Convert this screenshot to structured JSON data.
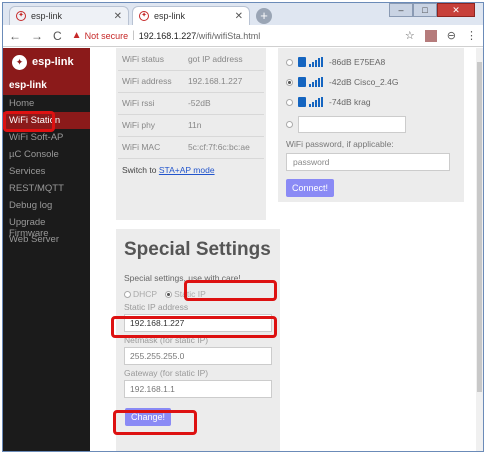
{
  "tabs": [
    {
      "title": "esp-link"
    },
    {
      "title": "esp-link"
    }
  ],
  "address": {
    "warning": "Not secure",
    "host": "192.168.1.227",
    "path": "/wifi/wifiSta.html"
  },
  "sidebar": {
    "brand": "esp-link",
    "subtitle": "esp-link",
    "items": [
      {
        "label": "Home"
      },
      {
        "label": "WiFi Station"
      },
      {
        "label": "WiFi Soft-AP"
      },
      {
        "label": "µC Console"
      },
      {
        "label": "Services"
      },
      {
        "label": "REST/MQTT"
      },
      {
        "label": "Debug log"
      },
      {
        "label": "Upgrade Firmware"
      },
      {
        "label": "Web Server"
      }
    ]
  },
  "wifi_status": {
    "rows": [
      {
        "label": "WiFi status",
        "value": "got IP address"
      },
      {
        "label": "WiFi address",
        "value": "192.168.1.227"
      },
      {
        "label": "WiFi rssi",
        "value": "-52dB"
      },
      {
        "label": "WiFi phy",
        "value": "11n"
      },
      {
        "label": "WiFi MAC",
        "value": "5c:cf:7f:6c:bc:ae"
      }
    ],
    "switch_prefix": "Switch to",
    "switch_link": "STA+AP mode"
  },
  "networks": {
    "items": [
      {
        "text": "-86dB E75EA8",
        "selected": false
      },
      {
        "text": "-42dB Cisco_2.4G",
        "selected": true
      },
      {
        "text": "-74dB krag",
        "selected": false
      }
    ],
    "password_label": "WiFi password, if applicable:",
    "password_placeholder": "password",
    "connect_label": "Connect!"
  },
  "special": {
    "title": "Special Settings",
    "note": "Special settings, use with care!",
    "dhcp_label": "DHCP",
    "static_label": "Static IP",
    "static_ip_label": "Static IP address",
    "static_ip_value": "192.168.1.227",
    "netmask_label": "Netmask (for static IP)",
    "netmask_value": "255.255.255.0",
    "gateway_label": "Gateway (for static IP)",
    "gateway_value": "192.168.1.1",
    "change_label": "Change!"
  },
  "colors": {
    "brand": "#8b1a1a",
    "highlight": "#dd1111",
    "button": "#8a8af5",
    "signal": "#1565c0"
  }
}
